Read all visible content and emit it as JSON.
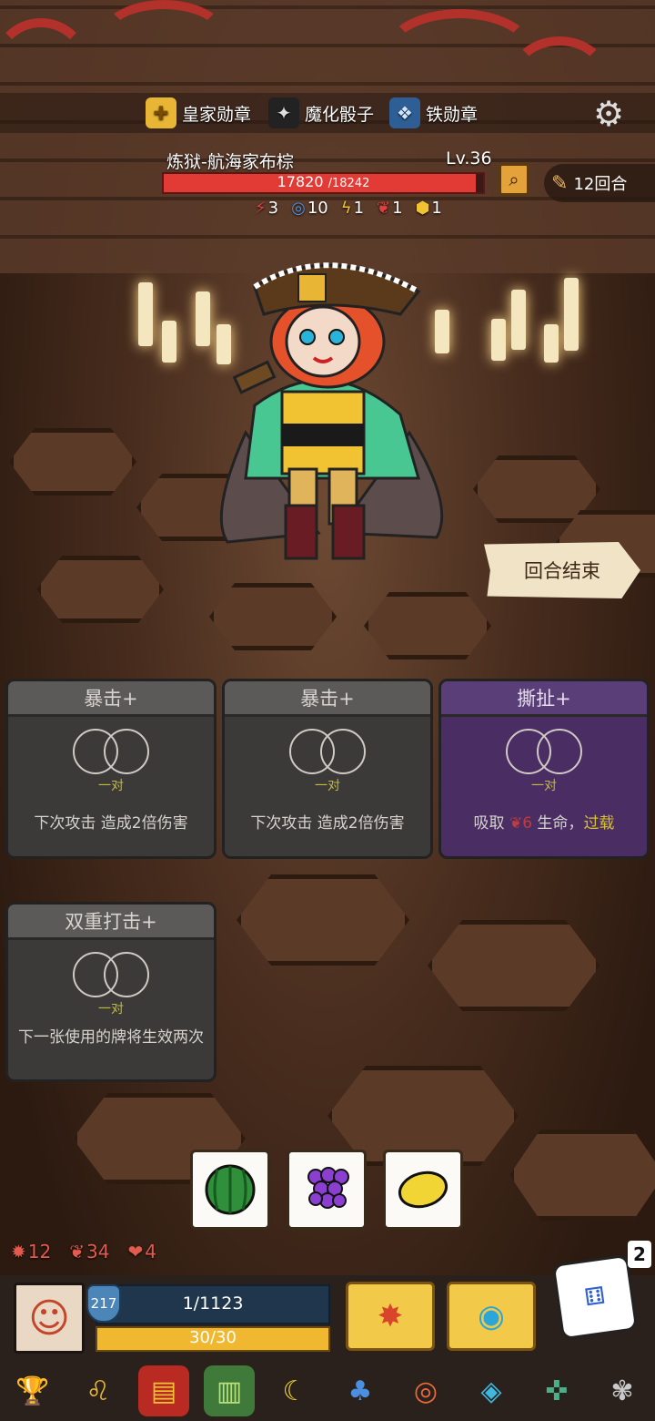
{
  "hud": {
    "medals": [
      {
        "label": "皇家勋章",
        "icon": "royal-medal-icon",
        "color": "#e8b634"
      },
      {
        "label": "魔化骰子",
        "icon": "demon-dice-icon",
        "color": "#dddddd"
      },
      {
        "label": "铁勋章",
        "icon": "iron-medal-icon",
        "color": "#6fa7e0"
      }
    ],
    "settings_icon": "gear-icon"
  },
  "enemy": {
    "name": "炼狱-航海家布棕",
    "level": "Lv.36",
    "hp_current": "17820",
    "hp_max": "/18242",
    "hp_fraction": 0.977,
    "stats": [
      {
        "icon": "crit-icon",
        "value": "3",
        "color": "#e04040"
      },
      {
        "icon": "vortex-icon",
        "value": "10",
        "color": "#4a90e2"
      },
      {
        "icon": "lightning-icon",
        "value": "1",
        "color": "#f1c232"
      },
      {
        "icon": "bleed-icon",
        "value": "1",
        "color": "#e04040"
      },
      {
        "icon": "armor-icon",
        "value": "1",
        "color": "#f1c232"
      }
    ]
  },
  "turn": {
    "label": "12回合"
  },
  "end_turn": {
    "label": "回合结束"
  },
  "cards": [
    {
      "title": "暴击+",
      "condition": "一对",
      "desc": "下次攻击 造成2倍伤害"
    },
    {
      "title": "暴击+",
      "condition": "一对",
      "desc": "下次攻击 造成2倍伤害"
    },
    {
      "title": "撕扯+",
      "condition": "一对",
      "desc_parts": [
        "吸取 ",
        "6",
        " 生命，",
        "过载"
      ]
    },
    {
      "title": "双重打击+",
      "condition": "一对",
      "desc": "下一张使用的牌将生效两次"
    }
  ],
  "dice": [
    {
      "face": "watermelon",
      "color": "#2f8f3a"
    },
    {
      "face": "grapes",
      "color": "#8b3fd0"
    },
    {
      "face": "lemon",
      "color": "#f1d534"
    }
  ],
  "player": {
    "stats": [
      {
        "icon": "crit-icon",
        "value": "12"
      },
      {
        "icon": "bleed-icon",
        "value": "34"
      },
      {
        "icon": "heart-icon",
        "value": "4"
      }
    ],
    "shield": "217",
    "hp": "1/1123",
    "energy": "30/30",
    "dice_count": "2"
  },
  "relics": [
    "trophy-icon",
    "lion-icon",
    "red-book-icon",
    "green-book-icon",
    "moon-star-icon",
    "mushroom-icon",
    "donut-icon",
    "crystal-icon",
    "compass-icon",
    "silver-beetle-icon"
  ]
}
